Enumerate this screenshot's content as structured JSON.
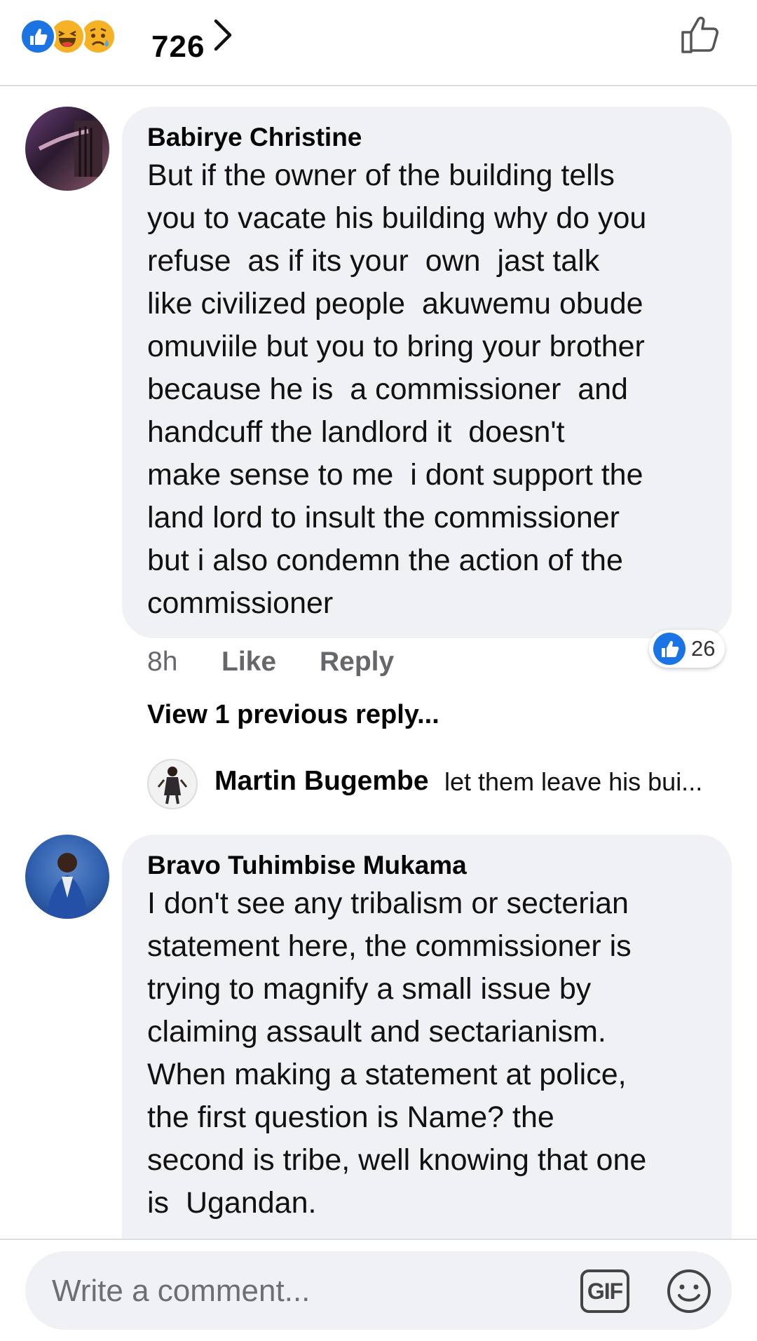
{
  "header": {
    "reactions": [
      "like-icon",
      "haha-icon",
      "sad-icon"
    ],
    "reaction_count": "726"
  },
  "comments": [
    {
      "author": "Babirye Christine",
      "text": "But if the owner of the building tells\nyou to vacate his building why do you\nrefuse  as if its your  own  jast talk\nlike civilized people  akuwemu obude\nomuviile but you to bring your brother\nbecause he is  a commissioner  and\nhandcuff the landlord it  doesn't\nmake sense to me  i dont support the\nland lord to insult the commissioner\nbut i also condemn the action of the\ncommissioner",
      "time": "8h",
      "like_label": "Like",
      "reply_label": "Reply",
      "like_count": "26",
      "view_replies": "View 1 previous reply...",
      "reply": {
        "author": "Martin Bugembe",
        "text": "let them leave his bui..."
      }
    },
    {
      "author": "Bravo Tuhimbise Mukama",
      "text": "I don't see any tribalism or secterian\nstatement here, the commissioner is\ntrying to magnify a small issue by\nclaiming assault and sectarianism.\nWhen making a statement at police,\nthe first question is Name? the\nsecond is tribe, well knowing that one\nis  Ugandan."
    }
  ],
  "composer": {
    "placeholder": "Write a comment...",
    "gif_label": "GIF"
  },
  "colors": {
    "accent": "#1b74e4",
    "bubble": "#eff1f5",
    "secondary_text": "#65676b"
  }
}
